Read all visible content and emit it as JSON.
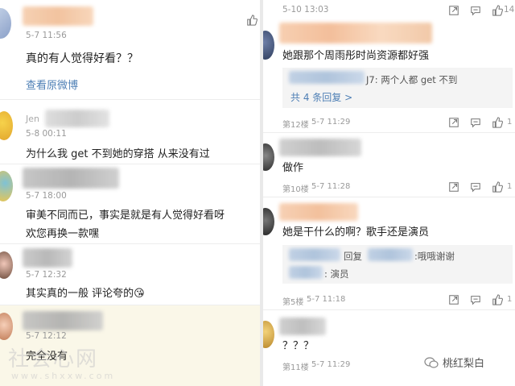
{
  "left": {
    "comments": [
      {
        "time": "5-7 11:56",
        "text": "真的有人觉得好看？？",
        "link": "查看原微博"
      },
      {
        "time": "5-8 00:11",
        "name_partial": "Jen",
        "text": "为什么我 get 不到她的穿搭 从来没有过"
      },
      {
        "time": "5-7 18:00",
        "text_line1": "审美不同而已，事实是就是有人觉得好看呀",
        "text_line2": "欢您再换一款嘿"
      },
      {
        "time": "5-7 12:32",
        "text": "其实真的一般 评论夸的😘"
      },
      {
        "time": "5-7 12:12",
        "text": "完全没有"
      }
    ],
    "watermark": {
      "main": "社会心网",
      "sub": "www.shxxw.com"
    }
  },
  "right": {
    "top_time": "5-10 13:03",
    "top_count": "14",
    "comments": [
      {
        "text": "她跟那个周雨彤时尚资源都好强",
        "quote_line": "J7: 两个人都 get 不到",
        "replies": "共 4 条回复 >",
        "floor": "第12楼",
        "time": "5-7 11:29",
        "likes": "1"
      },
      {
        "text": "做作",
        "floor": "第10楼",
        "time": "5-7 11:28",
        "likes": "1"
      },
      {
        "text": "她是干什么的啊？歌手还是演员",
        "quote_line1_mid": "回复",
        "quote_line1_end": ":哦哦谢谢",
        "quote_line2": ": 演员",
        "floor": "第5楼",
        "time": "5-7 11:18",
        "likes": "1"
      },
      {
        "text": "？？？",
        "floor": "第11楼",
        "time": "5-7 11:29"
      }
    ],
    "brand": "桃红梨白"
  }
}
